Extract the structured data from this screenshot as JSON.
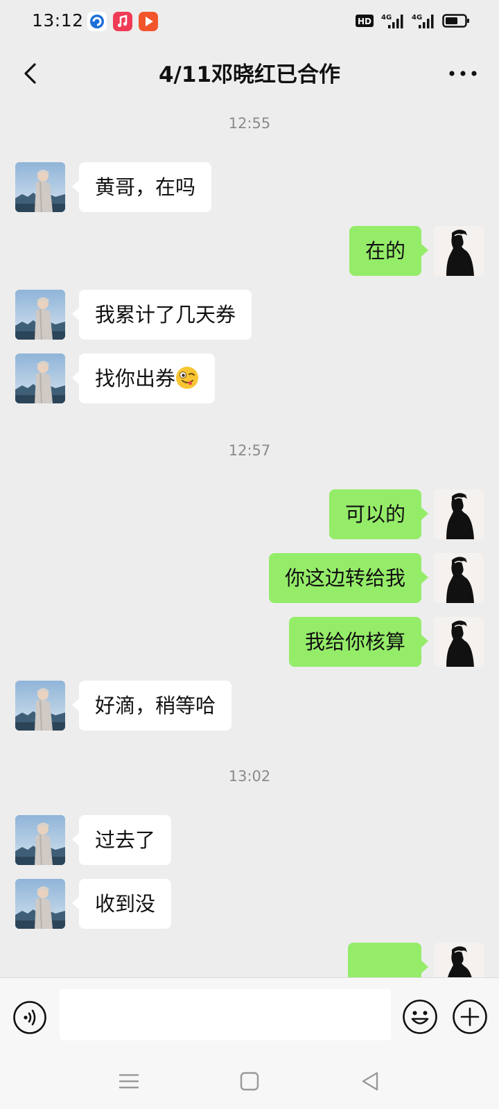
{
  "status_bar": {
    "time": "13:12",
    "app_icons": [
      {
        "name": "browser-app-icon",
        "color": "#1e6fd9"
      },
      {
        "name": "music-app-icon",
        "color": "#ef3b55"
      },
      {
        "name": "video-app-icon",
        "color": "#f2552c"
      }
    ],
    "hd_label": "HD",
    "network_1": "4G",
    "network_2": "4G"
  },
  "header": {
    "title": "4/11邓晓红已合作",
    "back_icon": "chevron-left-icon",
    "more_icon": "more-dots-icon"
  },
  "chat": {
    "bubble_colors": {
      "sent": "#95ec69",
      "received": "#ffffff"
    },
    "timestamps": [
      "12:55",
      "12:57",
      "13:02"
    ],
    "messages": [
      {
        "side": "left",
        "text": "黄哥，在吗"
      },
      {
        "side": "right",
        "text": "在的"
      },
      {
        "side": "left",
        "text": "我累计了几天券"
      },
      {
        "side": "left",
        "text": "找你出券",
        "emoji": "winking-tongue-emoji"
      },
      {
        "side": "right",
        "text": "可以的"
      },
      {
        "side": "right",
        "text": "你这边转给我"
      },
      {
        "side": "right",
        "text": "我给你核算"
      },
      {
        "side": "left",
        "text": "好滴，稍等哈"
      },
      {
        "side": "left",
        "text": "过去了"
      },
      {
        "side": "left",
        "text": "收到没"
      },
      {
        "side": "right",
        "text": ""
      }
    ]
  },
  "input_bar": {
    "value": "",
    "placeholder": "",
    "voice_icon": "voice-icon",
    "emoji_icon": "emoji-icon",
    "plus_icon": "plus-icon"
  },
  "nav_bar": {
    "icons": [
      "menu-icon",
      "home-icon",
      "back-triangle-icon"
    ]
  }
}
